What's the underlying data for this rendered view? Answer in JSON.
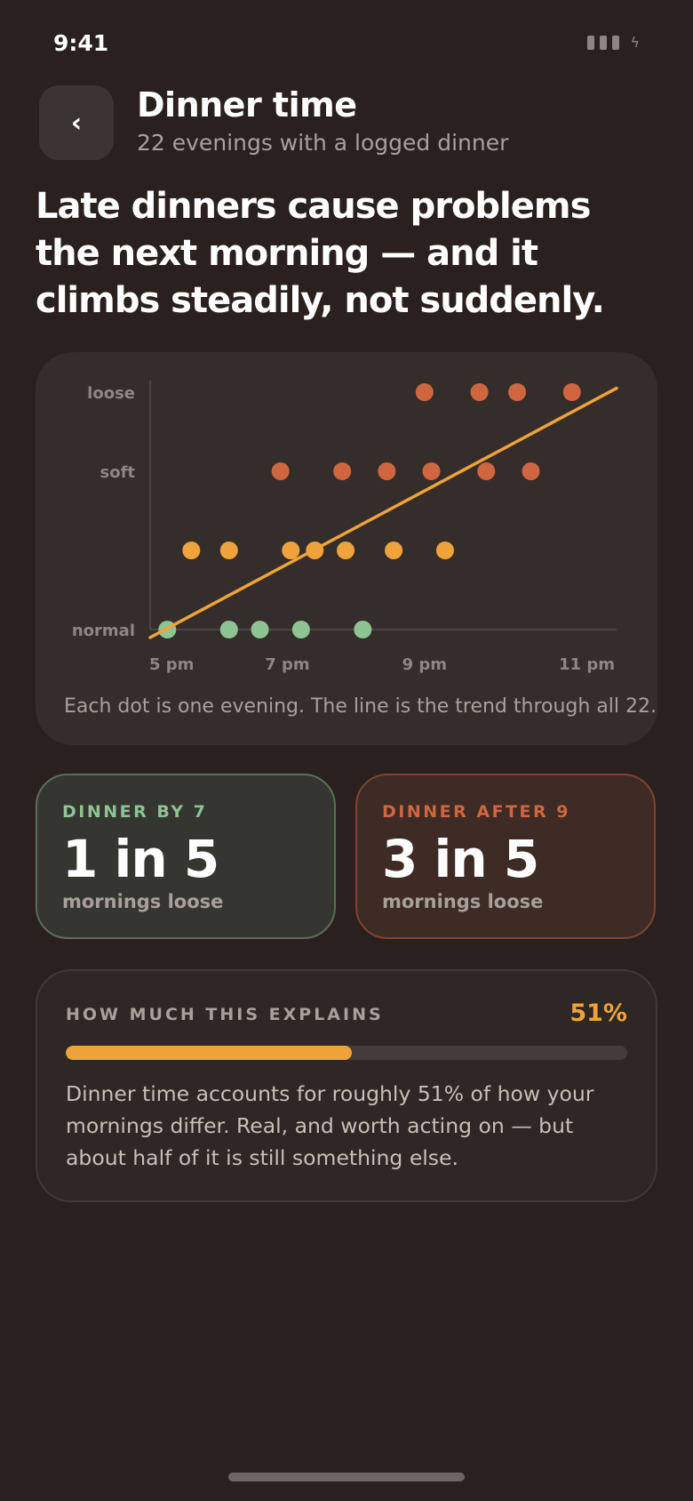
{
  "status_bar": {
    "time": "9:41"
  },
  "header": {
    "back_glyph": "‹",
    "title": "Dinner time",
    "subtitle": "22 evenings with a logged dinner"
  },
  "headline": "Late dinners cause problems the next morning — and it climbs steadily, not suddenly.",
  "chart_data": {
    "type": "scatter",
    "y_categories": [
      "normal",
      "",
      "soft",
      "loose"
    ],
    "y_tick_labels": [
      "normal",
      "soft",
      "loose"
    ],
    "x_ticks": [
      {
        "value": 17,
        "label": "5 pm"
      },
      {
        "value": 19,
        "label": "7 pm"
      },
      {
        "value": 21,
        "label": "9 pm"
      },
      {
        "value": 23,
        "label": "11 pm"
      }
    ],
    "xlim": [
      17,
      23.8
    ],
    "ylim": [
      0,
      3
    ],
    "series": [
      {
        "color": "#8ec394",
        "level": 0,
        "x": [
          17.25,
          18.15,
          18.6,
          19.2,
          20.1
        ]
      },
      {
        "color": "#eea33b",
        "level": 1,
        "x": [
          17.6,
          18.15,
          19.05,
          19.4,
          19.85,
          20.55,
          21.3
        ]
      },
      {
        "color": "#d06640",
        "level": 2,
        "x": [
          18.9,
          19.8,
          20.45,
          21.1,
          21.9,
          22.55
        ]
      },
      {
        "color": "#d06640",
        "level": 3,
        "x": [
          21.0,
          21.8,
          22.35,
          23.15
        ]
      }
    ],
    "trend": {
      "color": "#eea33b",
      "x": [
        17.0,
        23.8
      ],
      "y": [
        -0.1,
        3.05
      ]
    },
    "caption": "Each dot is one evening. The line is the trend through all 22."
  },
  "stats": [
    {
      "label": "DINNER BY 7",
      "value": "1 in 5",
      "sub": "mornings loose"
    },
    {
      "label": "DINNER AFTER 9",
      "value": "3 in 5",
      "sub": "mornings loose"
    }
  ],
  "explains": {
    "label": "HOW MUCH THIS EXPLAINS",
    "percent_text": "51%",
    "progress": 0.51,
    "body": "Dinner time accounts for roughly 51% of how your mornings differ. Real, and worth acting on — but about half of it is still something else."
  },
  "colors": {
    "accent": "#eea33b",
    "good": "#8ec394",
    "bad": "#d06640",
    "background": "#2a211f"
  }
}
